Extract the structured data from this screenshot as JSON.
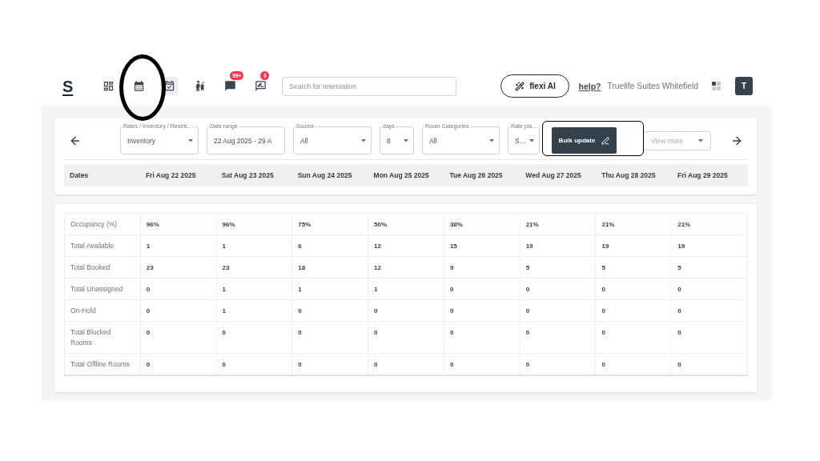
{
  "top_bar": {
    "logo": "S",
    "nav_icons": [
      {
        "selected": false
      },
      {
        "selected": false
      },
      {
        "selected": true
      },
      {
        "selected": false
      },
      {
        "selected": false,
        "badge": "99+"
      },
      {
        "selected": false,
        "badge": "3"
      }
    ],
    "search": {
      "placeholder": "Search for reservation"
    },
    "ai_button": "flexi AI",
    "help_link": "help?",
    "property_name": "Truelife Suites Whitefield",
    "avatar": "T"
  },
  "filters_bar": {
    "fields": [
      {
        "kind": "select",
        "label": "Rates / Inventory / Restric…",
        "value": "Inventory"
      },
      {
        "kind": "text",
        "label": "Date range",
        "value": "22 Aug 2025 - 29 A"
      },
      {
        "kind": "select",
        "label": "Source",
        "value": "All"
      },
      {
        "kind": "select",
        "label": "days",
        "value": "8"
      },
      {
        "kind": "select",
        "label": "Room Categories",
        "value": "All"
      },
      {
        "kind": "select",
        "label": "Rate pla…",
        "value": "S…"
      }
    ],
    "bulk_button": "Bulk update",
    "view_more": {
      "label": "View more",
      "disabled": true
    }
  },
  "date_header": {
    "columns": [
      "Dates",
      "Fri Aug 22 2025",
      "Sat Aug 23 2025",
      "Sun Aug 24 2025",
      "Mon Aug 25 2025",
      "Tue Aug 26 2025",
      "Wed Aug 27 2025",
      "Thu Aug 28 2025",
      "Fri Aug 29 2025"
    ]
  },
  "summary_table": {
    "rows": [
      {
        "label": "Occupancy (%)",
        "cells": [
          "96%",
          "96%",
          "75%",
          "50%",
          "38%",
          "21%",
          "21%",
          "21%"
        ]
      },
      {
        "label": "Total Available",
        "cells": [
          "1",
          "1",
          "6",
          "12",
          "15",
          "19",
          "19",
          "19"
        ]
      },
      {
        "label": "Total Booked",
        "cells": [
          "23",
          "23",
          "18",
          "12",
          "9",
          "5",
          "5",
          "5"
        ]
      },
      {
        "label": "Total Unassigned",
        "cells": [
          "0",
          "1",
          "1",
          "1",
          "0",
          "0",
          "0",
          "0"
        ]
      },
      {
        "label": "On-Hold",
        "cells": [
          "0",
          "1",
          "0",
          "0",
          "0",
          "0",
          "0",
          "0"
        ]
      },
      {
        "label": "Total Blocked Rooms",
        "cells": [
          "0",
          "0",
          "0",
          "0",
          "0",
          "0",
          "0",
          "0"
        ]
      },
      {
        "label": "Total Offline Rooms",
        "cells": [
          "0",
          "0",
          "0",
          "0",
          "0",
          "0",
          "0",
          "0"
        ]
      }
    ]
  },
  "annotations": [
    {
      "kind": "ellipse"
    },
    {
      "kind": "rectangle"
    }
  ]
}
